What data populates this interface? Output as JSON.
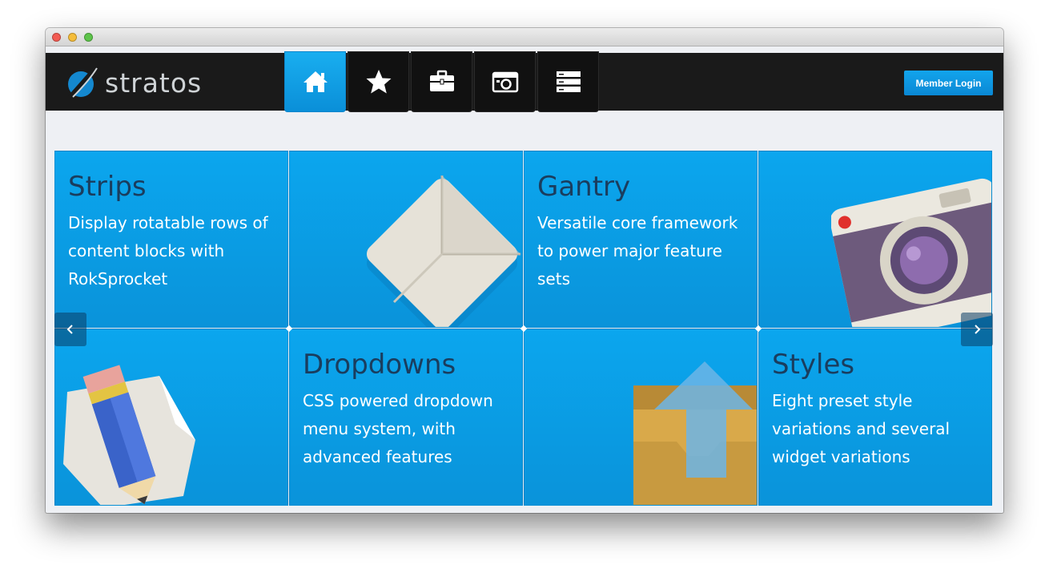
{
  "brand": {
    "name": "stratos"
  },
  "nav": [
    {
      "icon": "home-icon",
      "active": true
    },
    {
      "icon": "star-icon",
      "active": false
    },
    {
      "icon": "briefcase-icon",
      "active": false
    },
    {
      "icon": "camera-icon",
      "active": false
    },
    {
      "icon": "server-icon",
      "active": false
    }
  ],
  "header": {
    "login_label": "Member Login"
  },
  "tiles": {
    "strips": {
      "title": "Strips",
      "text": "Display rotatable rows of content blocks with RokSprocket"
    },
    "gantry": {
      "title": "Gantry",
      "text": "Versatile core framework to power major feature sets"
    },
    "dropdowns": {
      "title": "Dropdowns",
      "text": "CSS powered dropdown menu system, with advanced features"
    },
    "styles": {
      "title": "Styles",
      "text": "Eight preset style variations and several widget variations"
    }
  },
  "colors": {
    "accent": "#0ba6ee",
    "header_bg": "#1a1a1a",
    "title_text": "#1a3d5e"
  }
}
